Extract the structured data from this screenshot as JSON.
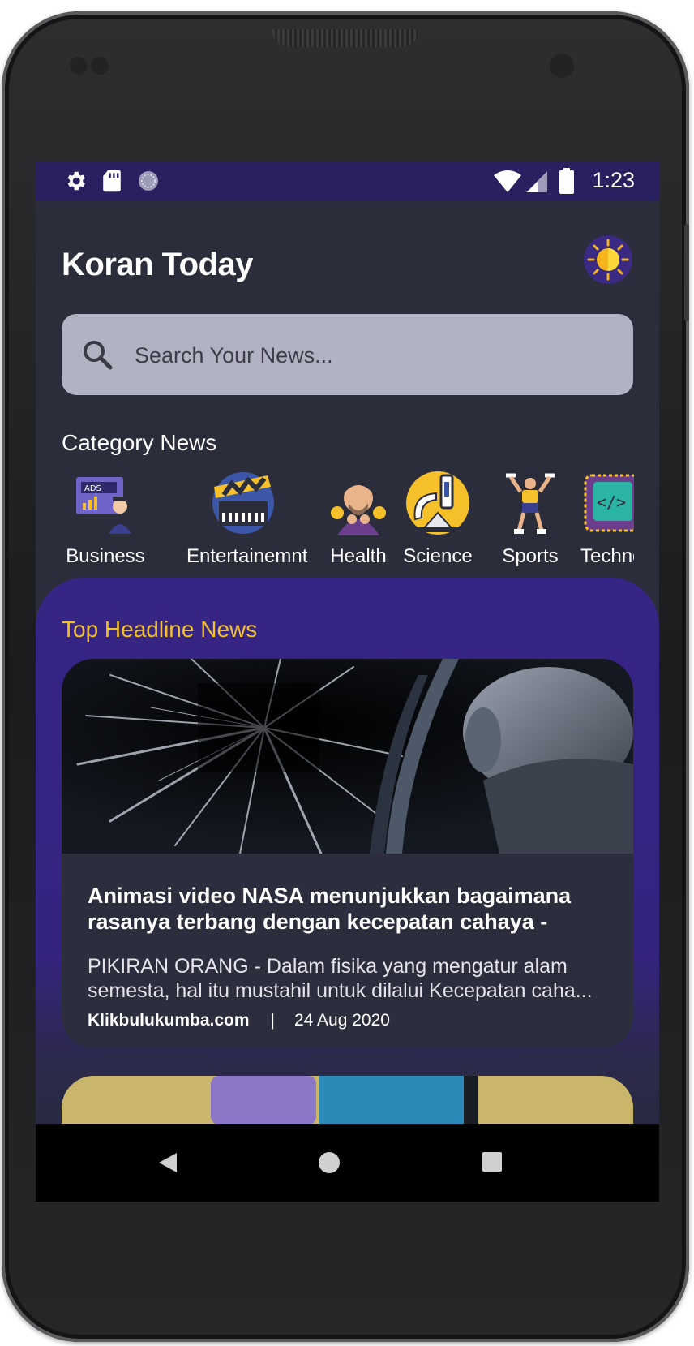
{
  "status_bar": {
    "time": "1:23",
    "left_icons": [
      "settings-icon",
      "sd-card-icon",
      "sync-icon"
    ],
    "right_icons": [
      "wifi-icon",
      "cell-signal-icon",
      "battery-icon"
    ]
  },
  "app": {
    "title": "Koran Today",
    "theme_toggle_icon": "sun-icon"
  },
  "search": {
    "placeholder": "Search Your News..."
  },
  "categories": {
    "title": "Category News",
    "items": [
      {
        "label": "Business",
        "icon": "business-icon"
      },
      {
        "label": "Entertainemnt",
        "icon": "entertainment-icon"
      },
      {
        "label": "Health",
        "icon": "health-icon"
      },
      {
        "label": "Science",
        "icon": "science-icon"
      },
      {
        "label": "Sports",
        "icon": "sports-icon"
      },
      {
        "label": "Techno",
        "icon": "technology-icon"
      }
    ]
  },
  "headlines": {
    "title": "Top Headline News",
    "articles": [
      {
        "title": "Animasi video NASA menunjukkan bagaimana rasanya terbang dengan kecepatan cahaya - Klik...",
        "description": "PIKIRAN ORANG - Dalam fisika yang mengatur alam semesta, hal itu mustahil untuk dilalui Kecepatan caha...",
        "source": "Klikbulukumba.com",
        "separator": "|",
        "date": "24 Aug 2020"
      }
    ]
  },
  "colors": {
    "status_bar": "#29205f",
    "background": "#2b2d3a",
    "headline_panel": "#372585",
    "accent": "#f5c02a",
    "search_bg": "#b1b2c2",
    "card_bg": "#2c2e3d"
  },
  "nav_bar": {
    "icons": [
      "back-icon",
      "home-icon",
      "recents-icon"
    ]
  }
}
